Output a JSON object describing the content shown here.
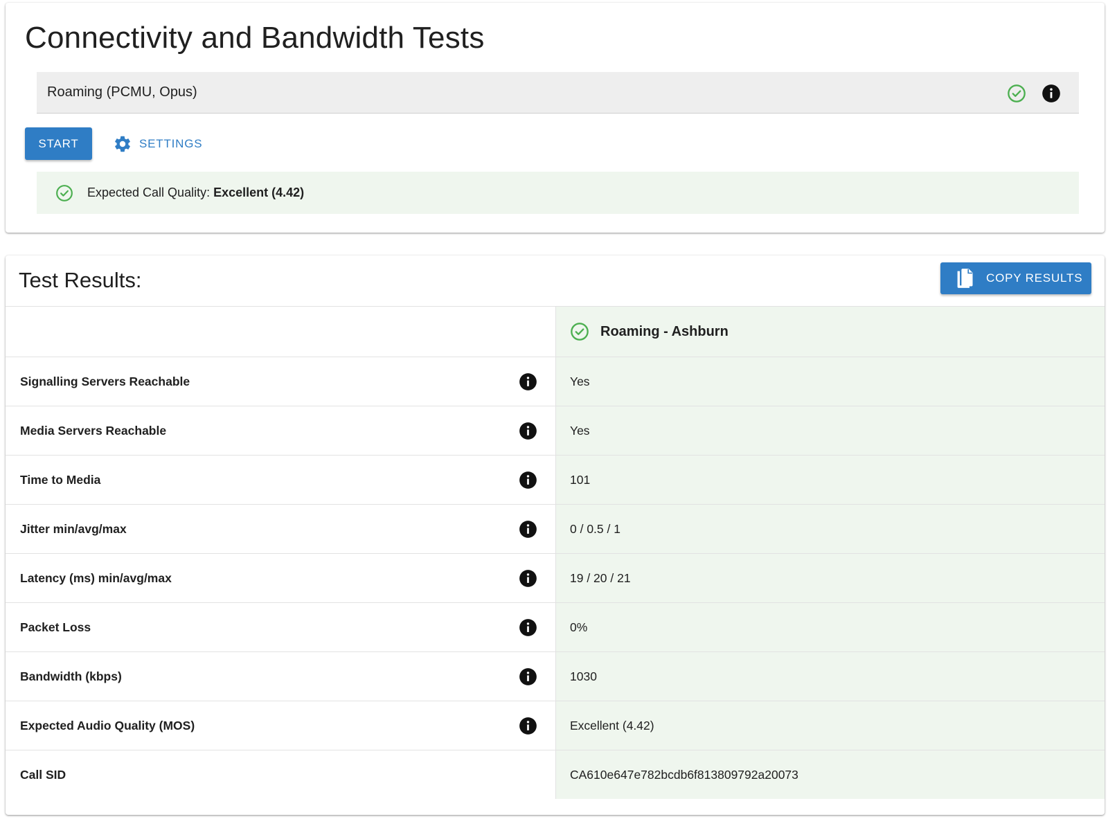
{
  "page": {
    "title": "Connectivity and Bandwidth Tests"
  },
  "selector": {
    "value": "Roaming (PCMU, Opus)"
  },
  "actions": {
    "start_label": "START",
    "settings_label": "SETTINGS"
  },
  "quality": {
    "prefix": "Expected Call Quality: ",
    "value": "Excellent (4.42)"
  },
  "results": {
    "title": "Test Results:",
    "copy_label": "COPY RESULTS",
    "column_header": "Roaming - Ashburn",
    "rows": [
      {
        "label": "Signalling Servers Reachable",
        "value": "Yes",
        "has_info": true
      },
      {
        "label": "Media Servers Reachable",
        "value": "Yes",
        "has_info": true
      },
      {
        "label": "Time to Media",
        "value": "101",
        "has_info": true
      },
      {
        "label": "Jitter min/avg/max",
        "value": "0 / 0.5 / 1",
        "has_info": true
      },
      {
        "label": "Latency (ms) min/avg/max",
        "value": "19 / 20 / 21",
        "has_info": true
      },
      {
        "label": "Packet Loss",
        "value": "0%",
        "has_info": true
      },
      {
        "label": "Bandwidth (kbps)",
        "value": "1030",
        "has_info": true
      },
      {
        "label": "Expected Audio Quality (MOS)",
        "value": "Excellent (4.42)",
        "has_info": true
      },
      {
        "label": "Call SID",
        "value": "CA610e647e782bcdb6f813809792a20073",
        "has_info": false
      }
    ]
  },
  "icons": {
    "check": "check-circle-icon",
    "info": "info-icon",
    "gear": "gear-icon",
    "copy": "copy-icon"
  },
  "colors": {
    "primary": "#2f7dc5",
    "success": "#4caf50",
    "success_bg": "#eff6ee",
    "field_bg": "#eeeeee"
  }
}
